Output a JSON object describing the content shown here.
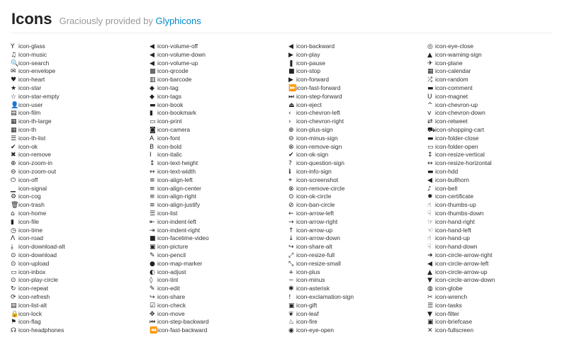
{
  "header": {
    "title": "Icons",
    "subtitle_prefix": "Graciously provided by",
    "subtitle_link": "Glyphicons"
  },
  "columns": [
    [
      {
        "name": "icon-glass",
        "glyph": "Y"
      },
      {
        "name": "icon-music",
        "glyph": "♫"
      },
      {
        "name": "icon-search",
        "glyph": "🔍"
      },
      {
        "name": "icon-envelope",
        "glyph": "✉"
      },
      {
        "name": "icon-heart",
        "glyph": "♥"
      },
      {
        "name": "icon-star",
        "glyph": "★"
      },
      {
        "name": "icon-star-empty",
        "glyph": "☆"
      },
      {
        "name": "icon-user",
        "glyph": "👤"
      },
      {
        "name": "icon-film",
        "glyph": "▤"
      },
      {
        "name": "icon-th-large",
        "glyph": "▦"
      },
      {
        "name": "icon-th",
        "glyph": "▦"
      },
      {
        "name": "icon-th-list",
        "glyph": "☰"
      },
      {
        "name": "icon-ok",
        "glyph": "✔"
      },
      {
        "name": "icon-remove",
        "glyph": "✖"
      },
      {
        "name": "icon-zoom-in",
        "glyph": "⊕"
      },
      {
        "name": "icon-zoom-out",
        "glyph": "⊖"
      },
      {
        "name": "icon-off",
        "glyph": "⏻"
      },
      {
        "name": "icon-signal",
        "glyph": "▁"
      },
      {
        "name": "icon-cog",
        "glyph": "⚙"
      },
      {
        "name": "icon-trash",
        "glyph": "🗑"
      },
      {
        "name": "icon-home",
        "glyph": "⌂"
      },
      {
        "name": "icon-file",
        "glyph": "▮"
      },
      {
        "name": "icon-time",
        "glyph": "◷"
      },
      {
        "name": "icon-road",
        "glyph": "Λ"
      },
      {
        "name": "icon-download-alt",
        "glyph": "⤓"
      },
      {
        "name": "icon-download",
        "glyph": "⊙"
      },
      {
        "name": "icon-upload",
        "glyph": "⊙"
      },
      {
        "name": "icon-inbox",
        "glyph": "▭"
      },
      {
        "name": "icon-play-circle",
        "glyph": "⊙"
      },
      {
        "name": "icon-repeat",
        "glyph": "↻"
      },
      {
        "name": "icon-refresh",
        "glyph": "⟳"
      },
      {
        "name": "icon-list-alt",
        "glyph": "▤"
      },
      {
        "name": "icon-lock",
        "glyph": "🔒"
      },
      {
        "name": "icon-flag",
        "glyph": "⚑"
      },
      {
        "name": "icon-headphones",
        "glyph": "☊"
      }
    ],
    [
      {
        "name": "icon-volume-off",
        "glyph": "◀"
      },
      {
        "name": "icon-volume-down",
        "glyph": "◀"
      },
      {
        "name": "icon-volume-up",
        "glyph": "◀"
      },
      {
        "name": "icon-qrcode",
        "glyph": "▩"
      },
      {
        "name": "icon-barcode",
        "glyph": "▥"
      },
      {
        "name": "icon-tag",
        "glyph": "◆"
      },
      {
        "name": "icon-tags",
        "glyph": "◆"
      },
      {
        "name": "icon-book",
        "glyph": "▬"
      },
      {
        "name": "icon-bookmark",
        "glyph": "▮"
      },
      {
        "name": "icon-print",
        "glyph": "▭"
      },
      {
        "name": "icon-camera",
        "glyph": "◙"
      },
      {
        "name": "icon-font",
        "glyph": "A"
      },
      {
        "name": "icon-bold",
        "glyph": "B"
      },
      {
        "name": "icon-italic",
        "glyph": "I"
      },
      {
        "name": "icon-text-height",
        "glyph": "↕"
      },
      {
        "name": "icon-text-width",
        "glyph": "↔"
      },
      {
        "name": "icon-align-left",
        "glyph": "≡"
      },
      {
        "name": "icon-align-center",
        "glyph": "≡"
      },
      {
        "name": "icon-align-right",
        "glyph": "≡"
      },
      {
        "name": "icon-align-justify",
        "glyph": "≡"
      },
      {
        "name": "icon-list",
        "glyph": "☰"
      },
      {
        "name": "icon-indent-left",
        "glyph": "⇤"
      },
      {
        "name": "icon-indent-right",
        "glyph": "⇥"
      },
      {
        "name": "icon-facetime-video",
        "glyph": "■"
      },
      {
        "name": "icon-picture",
        "glyph": "▣"
      },
      {
        "name": "icon-pencil",
        "glyph": "✎"
      },
      {
        "name": "icon-map-marker",
        "glyph": "●"
      },
      {
        "name": "icon-adjust",
        "glyph": "◐"
      },
      {
        "name": "icon-tint",
        "glyph": "◊"
      },
      {
        "name": "icon-edit",
        "glyph": "✎"
      },
      {
        "name": "icon-share",
        "glyph": "↪"
      },
      {
        "name": "icon-check",
        "glyph": "☑"
      },
      {
        "name": "icon-move",
        "glyph": "✥"
      },
      {
        "name": "icon-step-backward",
        "glyph": "⏮"
      },
      {
        "name": "icon-fast-backward",
        "glyph": "⏪"
      }
    ],
    [
      {
        "name": "icon-backward",
        "glyph": "◀"
      },
      {
        "name": "icon-play",
        "glyph": "▶"
      },
      {
        "name": "icon-pause",
        "glyph": "❚"
      },
      {
        "name": "icon-stop",
        "glyph": "■"
      },
      {
        "name": "icon-forward",
        "glyph": "▶"
      },
      {
        "name": "icon-fast-forward",
        "glyph": "⏩"
      },
      {
        "name": "icon-step-forward",
        "glyph": "⏭"
      },
      {
        "name": "icon-eject",
        "glyph": "⏏"
      },
      {
        "name": "icon-chevron-left",
        "glyph": "‹"
      },
      {
        "name": "icon-chevron-right",
        "glyph": "›"
      },
      {
        "name": "icon-plus-sign",
        "glyph": "⊕"
      },
      {
        "name": "icon-minus-sign",
        "glyph": "⊖"
      },
      {
        "name": "icon-remove-sign",
        "glyph": "⊗"
      },
      {
        "name": "icon-ok-sign",
        "glyph": "✔"
      },
      {
        "name": "icon-question-sign",
        "glyph": "?"
      },
      {
        "name": "icon-info-sign",
        "glyph": "ℹ"
      },
      {
        "name": "icon-screenshot",
        "glyph": "⌖"
      },
      {
        "name": "icon-remove-circle",
        "glyph": "⊗"
      },
      {
        "name": "icon-ok-circle",
        "glyph": "⊙"
      },
      {
        "name": "icon-ban-circle",
        "glyph": "⊘"
      },
      {
        "name": "icon-arrow-left",
        "glyph": "←"
      },
      {
        "name": "icon-arrow-right",
        "glyph": "→"
      },
      {
        "name": "icon-arrow-up",
        "glyph": "↑"
      },
      {
        "name": "icon-arrow-down",
        "glyph": "↓"
      },
      {
        "name": "icon-share-alt",
        "glyph": "↪"
      },
      {
        "name": "icon-resize-full",
        "glyph": "⤢"
      },
      {
        "name": "icon-resize-small",
        "glyph": "⤡"
      },
      {
        "name": "icon-plus",
        "glyph": "+"
      },
      {
        "name": "icon-minus",
        "glyph": "−"
      },
      {
        "name": "icon-asterisk",
        "glyph": "✱"
      },
      {
        "name": "icon-exclamation-sign",
        "glyph": "!"
      },
      {
        "name": "icon-gift",
        "glyph": "▣"
      },
      {
        "name": "icon-leaf",
        "glyph": "❦"
      },
      {
        "name": "icon-fire",
        "glyph": "♨"
      },
      {
        "name": "icon-eye-open",
        "glyph": "◉"
      }
    ],
    [
      {
        "name": "icon-eye-close",
        "glyph": "◎"
      },
      {
        "name": "icon-warning-sign",
        "glyph": "▲"
      },
      {
        "name": "icon-plane",
        "glyph": "✈"
      },
      {
        "name": "icon-calendar",
        "glyph": "▦"
      },
      {
        "name": "icon-random",
        "glyph": "⤮"
      },
      {
        "name": "icon-comment",
        "glyph": "▬"
      },
      {
        "name": "icon-magnet",
        "glyph": "U"
      },
      {
        "name": "icon-chevron-up",
        "glyph": "^"
      },
      {
        "name": "icon-chevron-down",
        "glyph": "v"
      },
      {
        "name": "icon-retweet",
        "glyph": "⇄"
      },
      {
        "name": "icon-shopping-cart",
        "glyph": "⛟"
      },
      {
        "name": "icon-folder-close",
        "glyph": "▬"
      },
      {
        "name": "icon-folder-open",
        "glyph": "▭"
      },
      {
        "name": "icon-resize-vertical",
        "glyph": "↕"
      },
      {
        "name": "icon-resize-horizontal",
        "glyph": "↔"
      },
      {
        "name": "icon-hdd",
        "glyph": "▬"
      },
      {
        "name": "icon-bullhorn",
        "glyph": "◀"
      },
      {
        "name": "icon-bell",
        "glyph": "♪"
      },
      {
        "name": "icon-certificate",
        "glyph": "✹"
      },
      {
        "name": "icon-thumbs-up",
        "glyph": "☝"
      },
      {
        "name": "icon-thumbs-down",
        "glyph": "☟"
      },
      {
        "name": "icon-hand-right",
        "glyph": "☞"
      },
      {
        "name": "icon-hand-left",
        "glyph": "☜"
      },
      {
        "name": "icon-hand-up",
        "glyph": "☝"
      },
      {
        "name": "icon-hand-down",
        "glyph": "☟"
      },
      {
        "name": "icon-circle-arrow-right",
        "glyph": "➜"
      },
      {
        "name": "icon-circle-arrow-left",
        "glyph": "◀"
      },
      {
        "name": "icon-circle-arrow-up",
        "glyph": "▲"
      },
      {
        "name": "icon-circle-arrow-down",
        "glyph": "▼"
      },
      {
        "name": "icon-globe",
        "glyph": "◍"
      },
      {
        "name": "icon-wrench",
        "glyph": "✂"
      },
      {
        "name": "icon-tasks",
        "glyph": "☰"
      },
      {
        "name": "icon-filter",
        "glyph": "▼"
      },
      {
        "name": "icon-briefcase",
        "glyph": "▣"
      },
      {
        "name": "icon-fullscreen",
        "glyph": "✕"
      }
    ]
  ],
  "colors": {
    "link": "#0088cc",
    "subtitle": "#999999",
    "text": "#333333"
  }
}
